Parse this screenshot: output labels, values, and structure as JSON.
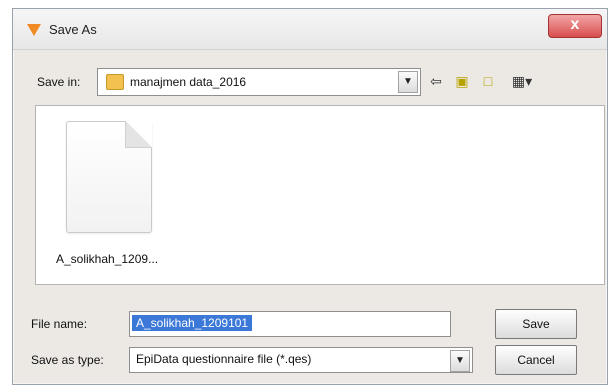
{
  "window": {
    "title": "Save As",
    "close_label": "x"
  },
  "save_in": {
    "label": "Save in:",
    "value": "manajmen data_2016"
  },
  "toolbar": {
    "back_icon": "⇦",
    "up_icon": "▣",
    "new_folder_icon": "□",
    "views_icon": "▦▾"
  },
  "files": [
    {
      "name": "A_solikhah_1209..."
    }
  ],
  "file_name": {
    "label": "File name:",
    "value": "A_solikhah_1209101"
  },
  "save_as_type": {
    "label": "Save as type:",
    "value": "EpiData questionnaire file (*.qes)"
  },
  "buttons": {
    "save": "Save",
    "cancel": "Cancel"
  }
}
